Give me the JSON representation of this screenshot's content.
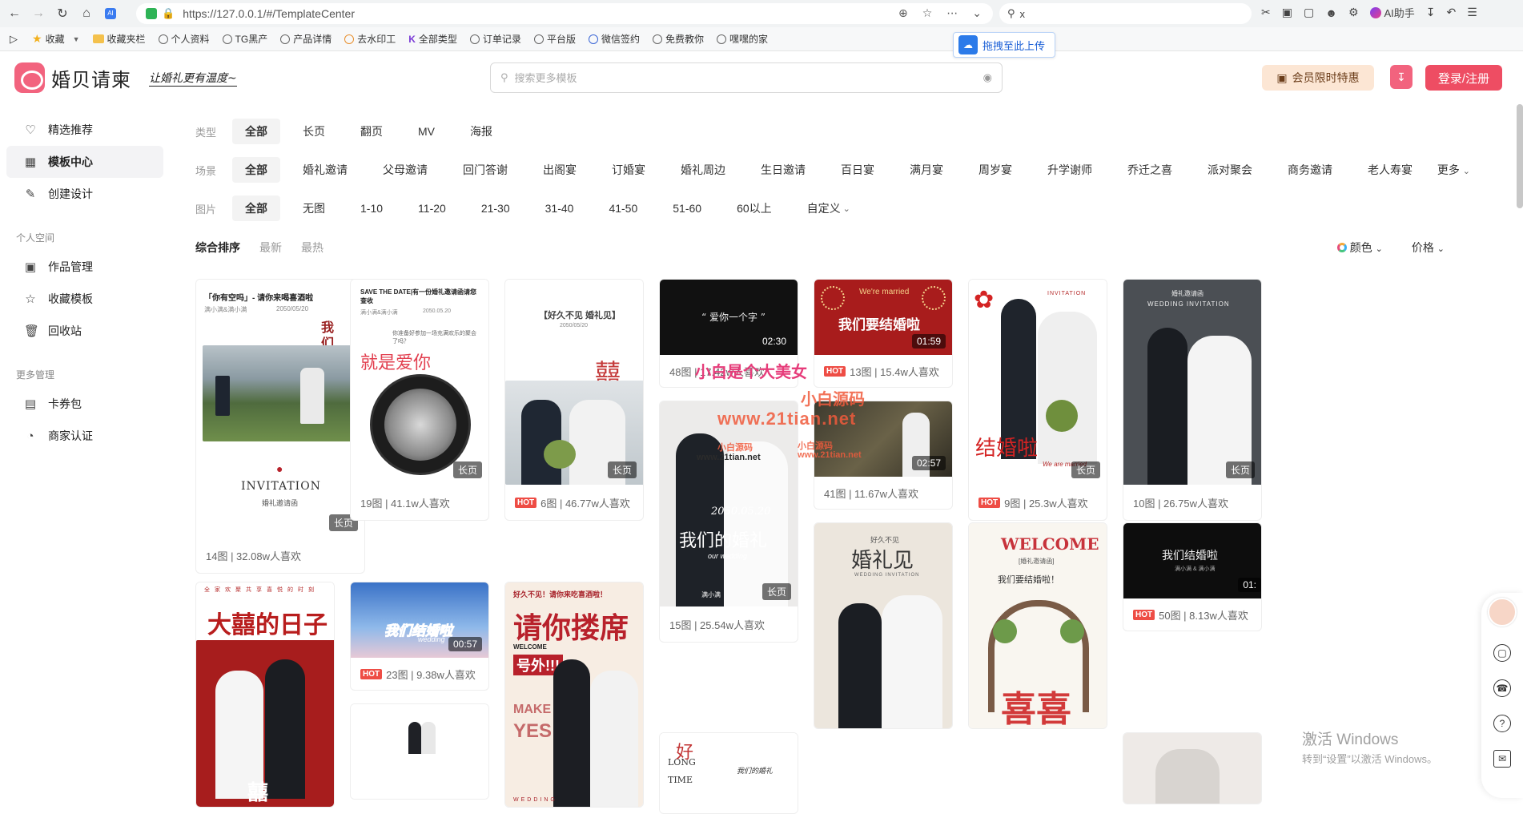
{
  "browser": {
    "url": "https://127.0.0.1/#/TemplateCenter",
    "search_value": "x",
    "ai_label": "AI助手",
    "bookmarks": [
      "收藏",
      "收藏夹栏",
      "个人资料",
      "TG黑产",
      "产品详情",
      "去水印工",
      "全部类型",
      "订单记录",
      "平台版",
      "微信签约",
      "免费教你",
      "嘿嘿的家"
    ],
    "upload_label": "拖拽至此上传"
  },
  "header": {
    "logo_text": "婚贝请柬",
    "slogan": "让婚礼更有温度~",
    "search_placeholder": "搜索更多模板",
    "vip_label": "会员限时特惠",
    "login_label": "登录/注册"
  },
  "sidebar": {
    "items": [
      {
        "label": "精选推荐",
        "icon": "heart-icon"
      },
      {
        "label": "模板中心",
        "icon": "grid-icon"
      },
      {
        "label": "创建设计",
        "icon": "edit-icon"
      }
    ],
    "group1": "个人空间",
    "personal": [
      {
        "label": "作品管理",
        "icon": "image-icon"
      },
      {
        "label": "收藏模板",
        "icon": "star-icon"
      },
      {
        "label": "回收站",
        "icon": "trash-icon"
      }
    ],
    "group2": "更多管理",
    "more": [
      {
        "label": "卡券包",
        "icon": "coupon-icon"
      },
      {
        "label": "商家认证",
        "icon": "shop-icon"
      }
    ]
  },
  "filters": {
    "type_label": "类型",
    "types": [
      "全部",
      "长页",
      "翻页",
      "MV",
      "海报"
    ],
    "scene_label": "场景",
    "scenes": [
      "全部",
      "婚礼邀请",
      "父母邀请",
      "回门答谢",
      "出阁宴",
      "订婚宴",
      "婚礼周边",
      "生日邀请",
      "百日宴",
      "满月宴",
      "周岁宴",
      "升学谢师",
      "乔迁之喜",
      "派对聚会",
      "商务邀请",
      "老人寿宴"
    ],
    "more_label": "更多",
    "image_label": "图片",
    "images": [
      "全部",
      "无图",
      "1-10",
      "11-20",
      "21-30",
      "31-40",
      "41-50",
      "51-60",
      "60以上",
      "自定义"
    ]
  },
  "sort": {
    "options": [
      "综合排序",
      "最新",
      "最热"
    ],
    "color_label": "颜色",
    "price_label": "价格"
  },
  "cards": [
    {
      "title": "「你有空吗」- 请你来喝喜酒啦",
      "sub": "满小满&满小满",
      "date": "2050/05/20",
      "text1": "我们在一起",
      "text2": "INVITATION",
      "text3": "婚礼邀请函",
      "tag": "长页",
      "info": "14图 | 32.08w人喜欢",
      "hot": false
    },
    {
      "title": "SAVE THE DATE|有一份婚礼邀请函请您查收",
      "sub": "满小满&满小满",
      "date": "2050.05.20",
      "text1": "就是爱你",
      "text2": "你准备好参加一场充满欢乐的聚会了吗？",
      "tag": "长页",
      "info": "19图 | 41.1w人喜欢",
      "hot": false
    },
    {
      "title": "【好久不见 婚礼见】",
      "date": "2050/05/20",
      "text1": "囍",
      "tag": "长页",
      "info": "6图 | 46.77w人喜欢",
      "hot": true
    },
    {
      "title": "“ 爱你一个字 ”",
      "duration": "02:30",
      "info": "48图 | 17.42w人喜欢",
      "hot": false
    },
    {
      "title": "我们要结婚啦",
      "sub": "We're married",
      "duration": "01:59",
      "info": "13图 | 15.4w人喜欢",
      "hot": true
    },
    {
      "title": "INVITATION",
      "text1": "结婚啦",
      "text2": "We are married",
      "tag": "长页",
      "info": "9图 | 25.3w人喜欢",
      "hot": true
    },
    {
      "title": "婚礼邀请函",
      "sub": "WEDDING INVITATION",
      "tag": "长页",
      "info": "10图 | 26.75w人喜欢",
      "hot": false
    },
    {
      "duration": "02:57",
      "info": "41图 | 11.67w人喜欢",
      "hot": false
    },
    {
      "text1": "2050.05.20",
      "text2": "我们的婚礼",
      "text3": "our wedding",
      "text4": "满小满",
      "tag": "长页",
      "info": "15图 | 25.54w人喜欢",
      "hot": false
    },
    {
      "title": "大囍的日子",
      "sub": "全家欢聚共享喜悦的时刻",
      "text1": "囍",
      "hot": false
    },
    {
      "title": "我们结婚啦",
      "sub": "wedding",
      "duration": "00:57",
      "info": "23图 | 9.38w人喜欢",
      "hot": true
    },
    {
      "title": "请你搂席",
      "sub": "好久不见！请你来吃喜酒啦！",
      "text1": "号外!!!",
      "text2": "WELCOME",
      "text3": "WEDDING",
      "text4": "MAKE",
      "text5": "YES",
      "hot": false
    },
    {
      "title": "婚礼见",
      "sub": "好久不见",
      "text1": "WEDDING INVITATION",
      "hot": false
    },
    {
      "title": "WELCOME",
      "sub": "[婚礼邀请函]",
      "text1": "我们要结婚啦！",
      "text2": "喜喜",
      "hot": false
    },
    {
      "title": "我们结婚啦",
      "sub": "满小满 & 满小满",
      "duration": "01:",
      "info": "50图 | 8.13w人喜欢",
      "hot": true
    },
    {
      "text1": "LONG",
      "text2": "TIME",
      "text3": "我们的婚礼",
      "text4": "好",
      "hot": false
    }
  ],
  "watermarks": [
    "小白源码",
    "www.21tian.net",
    "小白是个大美女",
    "小白源码",
    "www.21tian.net",
    "小白源码",
    "www.21tian.net"
  ],
  "windows": {
    "line1": "激活 Windows",
    "line2": "转到“设置”以激活 Windows。"
  },
  "hot_label": "HOT"
}
